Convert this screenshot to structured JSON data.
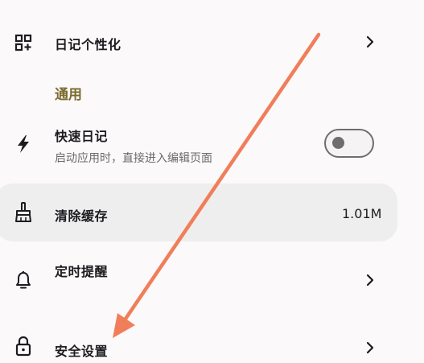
{
  "settings": {
    "personalize": {
      "title": "日记个性化",
      "icon": "grid-plus-icon"
    },
    "section_general": "通用",
    "quick_diary": {
      "title": "快速日记",
      "subtitle": "启动应用时，直接进入编辑页面",
      "toggle_on": false,
      "icon": "flash-icon"
    },
    "clear_cache": {
      "title": "清除缓存",
      "value": "1.01M",
      "icon": "broom-icon"
    },
    "scheduled_reminder": {
      "title": "定时提醒",
      "icon": "bell-icon"
    },
    "security": {
      "title": "安全设置",
      "icon": "lock-icon"
    }
  },
  "colors": {
    "background": "#fcf9fa",
    "section_accent": "#7a6a2e",
    "highlight_row": "#eeeeee",
    "annotation_arrow": "#f07e5a"
  }
}
